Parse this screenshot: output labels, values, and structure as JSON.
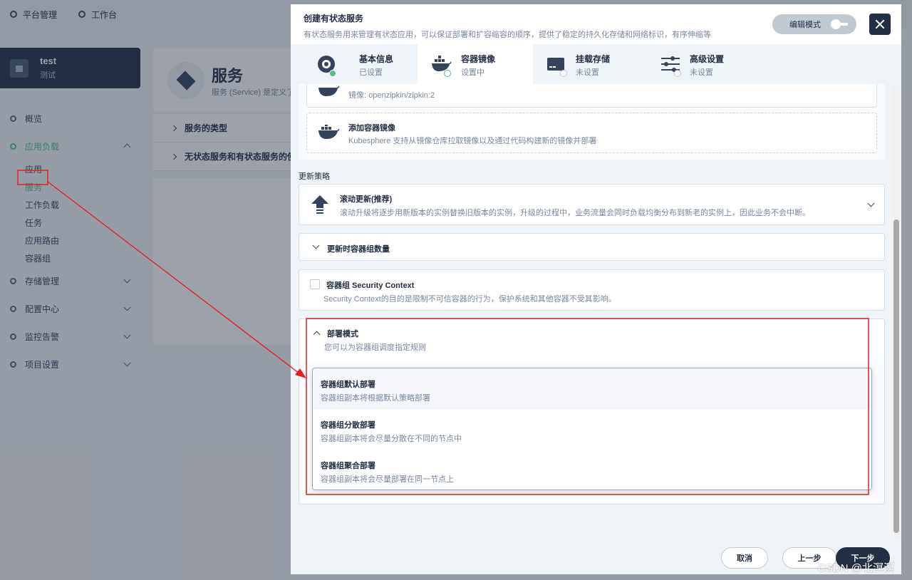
{
  "topbar": {
    "platform": "平台管理",
    "workbench": "工作台"
  },
  "project": {
    "name": "test",
    "alias": "测试"
  },
  "nav": {
    "overview": "概览",
    "app_workloads": "应用负载",
    "sub_items": [
      "应用",
      "服务",
      "工作负载",
      "任务",
      "应用路由",
      "容器组"
    ],
    "storage": "存储管理",
    "config": "配置中心",
    "monitoring": "监控告警",
    "project_settings": "项目设置"
  },
  "service_page": {
    "title": "服务",
    "desc": "服务 (Service) 是定义了",
    "fold1": "服务的类型",
    "fold2": "无状态服务和有状态服务的使用"
  },
  "modal": {
    "title": "创建有状态服务",
    "desc": "有状态服务用来管理有状态应用，可以保证部署和扩容缩容的顺序，提供了稳定的持久化存储和网络标识，有序伸缩等",
    "edit_mode": "编辑模式"
  },
  "tabs": [
    {
      "label": "基本信息",
      "status": "已设置"
    },
    {
      "label": "容器镜像",
      "status": "设置中"
    },
    {
      "label": "挂载存储",
      "status": "未设置"
    },
    {
      "label": "高级设置",
      "status": "未设置"
    }
  ],
  "image_card": {
    "image": "镜像: openzipkin/zipkin:2"
  },
  "add_image": {
    "title": "添加容器镜像",
    "desc": "Kubesphere 支持从镜像仓库拉取镜像以及通过代码构建新的镜像并部署"
  },
  "update_strategy": {
    "label": "更新策略",
    "title": "滚动更新(推荐)",
    "desc": "滚动升级将逐步用新版本的实例替换旧版本的实例，升级的过程中，业务流量会同时负载均衡分布到新老的实例上，因此业务不会中断。"
  },
  "update_pods": {
    "title": "更新时容器组数量"
  },
  "security_context": {
    "title": "容器组 Security Context",
    "desc": "Security Context的目的是限制不可信容器的行为，保护系统和其他容器不受其影响。"
  },
  "deploy_mode": {
    "title": "部署模式",
    "desc": "您可以为容器组调度指定规则",
    "options": [
      {
        "title": "容器组默认部署",
        "desc": "容器组副本将根据默认策略部署"
      },
      {
        "title": "容器组分散部署",
        "desc": "容器组副本将会尽量分散在不同的节点中"
      },
      {
        "title": "容器组聚合部署",
        "desc": "容器组副本将会尽量部署在同一节点上"
      }
    ]
  },
  "footer": {
    "cancel": "取消",
    "prev": "上一步",
    "next": "下一步"
  },
  "watermark": "CSDN @北溟溟",
  "colors": {
    "accent": "#55bc8a",
    "dark": "#242e42",
    "annotation": "#e02020"
  }
}
